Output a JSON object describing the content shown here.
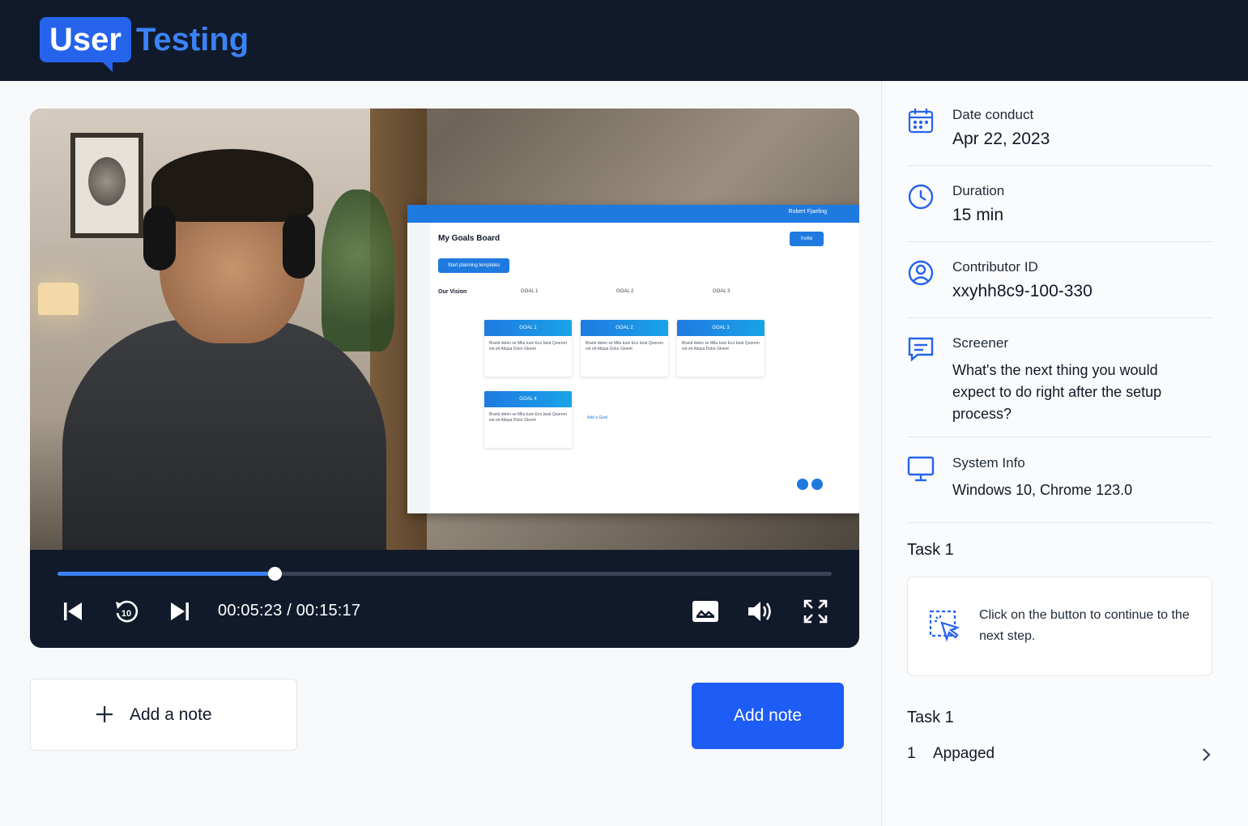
{
  "brand": {
    "logo_box": "User",
    "logo_text": "Testing",
    "accent": "#2563eb"
  },
  "player": {
    "current_time": "00:05:23",
    "total_time": "00:15:17",
    "time_display": "00:05:23 / 00:15:17",
    "progress": 0.28,
    "icons": [
      "skip-back-icon",
      "rewind-10-icon",
      "skip-forward-icon",
      "captions-icon",
      "volume-icon",
      "fullscreen-icon"
    ],
    "rewind_label": "10"
  },
  "video_screen": {
    "board_title": "My Goals Board",
    "start_button": "Start planning templates",
    "invite_button": "Invite",
    "vision_label": "Our Vision",
    "columns": [
      "GOAL 1",
      "GOAL 2",
      "GOAL 3"
    ],
    "goal_cards": [
      "GOAL 1",
      "GOAL 2",
      "GOAL 3",
      "GOAL 4"
    ],
    "card_text": "Brand delen se Mila tuon Eco beat Quorem est eit Aliqua Dolor Gloent",
    "add_goal": "Add a Goal",
    "user_name": "Robert Fjaeling"
  },
  "notes": {
    "field_label": "Add a note",
    "button_label": "Add note"
  },
  "info": [
    {
      "label": "Date conduct",
      "value": "Apr 22, 2023",
      "icon": "calendar-icon"
    },
    {
      "label": "Duration",
      "value": "15 min",
      "icon": "clock-icon"
    },
    {
      "label": "Contributor ID",
      "value": "xxyhh8c9-100-330",
      "icon": "user-circle-icon"
    },
    {
      "label": "Screener",
      "value": "What's the next thing you would expect to do right after the setup process?",
      "icon": "chat-icon"
    },
    {
      "label": "System Info",
      "value": "Windows 10, Chrome 123.0",
      "icon": "monitor-icon"
    }
  ],
  "task_section": {
    "title": "Task 1",
    "card_text": "Click on the button to continue to the next step.",
    "card_icon": "click-select-icon"
  },
  "task_list": {
    "title": "Task 1",
    "items": [
      {
        "number": "1",
        "name": "Appaged"
      }
    ]
  }
}
